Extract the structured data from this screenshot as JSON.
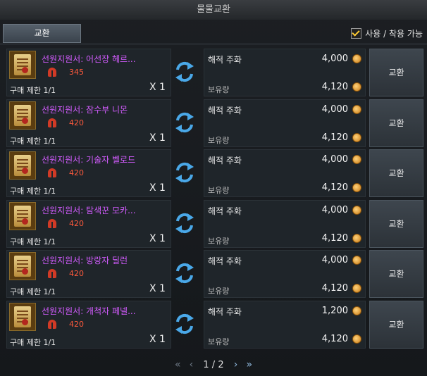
{
  "window": {
    "title": "물물교환"
  },
  "tabs": [
    {
      "label": "교환"
    }
  ],
  "filter": {
    "label": "사용 / 착용 가능",
    "checked": true
  },
  "rows": [
    {
      "name": "선원지원서: 어선장 헤르...",
      "level": "345",
      "limit": "구매 제한 1/1",
      "qty": "X 1",
      "currency": "해적 주화",
      "price": "4,000",
      "owned_label": "보유량",
      "owned": "4,120",
      "button": "교환"
    },
    {
      "name": "선원지원서: 잠수부 니몬",
      "level": "420",
      "limit": "구매 제한 1/1",
      "qty": "X 1",
      "currency": "해적 주화",
      "price": "4,000",
      "owned_label": "보유량",
      "owned": "4,120",
      "button": "교환"
    },
    {
      "name": "선원지원서: 기술자 벨로드",
      "level": "420",
      "limit": "구매 제한 1/1",
      "qty": "X 1",
      "currency": "해적 주화",
      "price": "4,000",
      "owned_label": "보유량",
      "owned": "4,120",
      "button": "교환"
    },
    {
      "name": "선원지원서: 탐색꾼 모카...",
      "level": "420",
      "limit": "구매 제한 1/1",
      "qty": "X 1",
      "currency": "해적 주화",
      "price": "4,000",
      "owned_label": "보유량",
      "owned": "4,120",
      "button": "교환"
    },
    {
      "name": "선원지원서: 방랑자 딜런",
      "level": "420",
      "limit": "구매 제한 1/1",
      "qty": "X 1",
      "currency": "해적 주화",
      "price": "4,000",
      "owned_label": "보유량",
      "owned": "4,120",
      "button": "교환"
    },
    {
      "name": "선원지원서: 개척자 페넬...",
      "level": "420",
      "limit": "구매 제한 1/1",
      "qty": "X 1",
      "currency": "해적 주화",
      "price": "1,200",
      "owned_label": "보유량",
      "owned": "4,120",
      "button": "교환"
    }
  ],
  "pagination": {
    "text": "1 / 2"
  },
  "icons": {
    "item": "scroll-icon",
    "level": "helmet-icon",
    "exchange": "swap-arrows-icon",
    "currency": "coin-icon",
    "first": "double-chevron-left-icon",
    "prev": "chevron-left-icon",
    "next": "chevron-right-icon",
    "last": "double-chevron-right-icon"
  },
  "colors": {
    "item_name": "#d35cff",
    "level": "#ff5a3c",
    "coin": "#e8a02a",
    "checkmark": "#ffcc33"
  }
}
